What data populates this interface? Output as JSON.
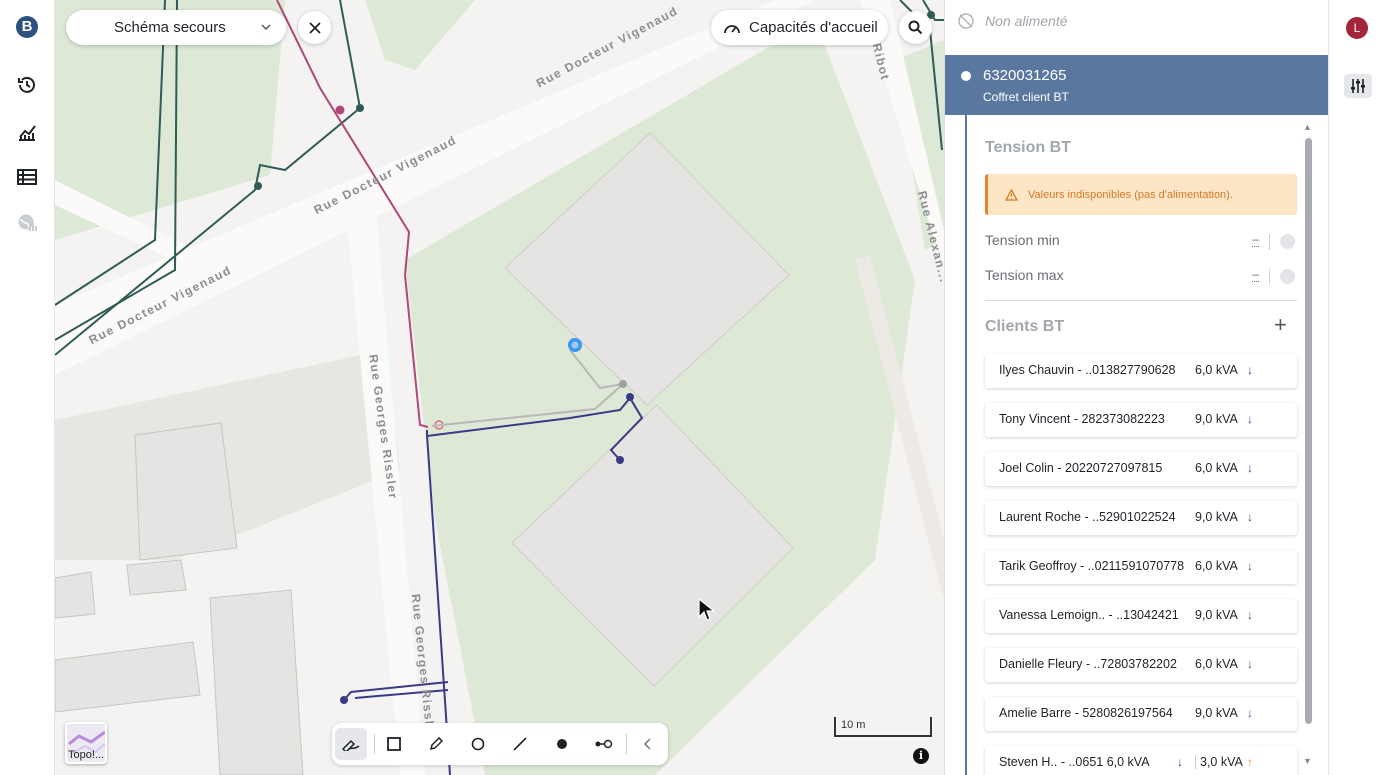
{
  "nav": {
    "logo_letter": "B",
    "items": [
      {
        "name": "history-icon"
      },
      {
        "name": "chart-icon"
      },
      {
        "name": "table-icon"
      },
      {
        "name": "globe-chart-icon"
      }
    ]
  },
  "map": {
    "schema_select_label": "Schéma secours",
    "capacity_button_label": "Capacités d'accueil",
    "streets": {
      "docteur_vigenaud_1": "Rue Docteur Vigenaud",
      "docteur_vigenaud_2": "Rue Docteur Vigenaud",
      "docteur_vigenaud_3": "Rue Docteur Vigenaud",
      "georges_rissler_1": "Rue Georges Rissler",
      "georges_rissler_2": "Rue Georges Rissler",
      "ribot": "Ribot",
      "alexandre": "Rue Alexan..."
    },
    "scale_label": "10 m",
    "topo_label": "Topo!...",
    "info_label": "i"
  },
  "toolbar": {
    "tools": [
      "freehand-draw-icon",
      "rectangle-icon",
      "pencil-icon",
      "circle-icon",
      "line-icon",
      "point-icon",
      "connector-icon",
      "collapse-chevron-icon"
    ]
  },
  "panel": {
    "not_powered_label": "Non alimenté",
    "selected": {
      "id": "6320031265",
      "type": "Coffret client BT"
    },
    "tension_section": {
      "title": "Tension BT",
      "warning": "Valeurs indisponibles (pas d'alimentation).",
      "rows": [
        {
          "label": "Tension min",
          "value": "–"
        },
        {
          "label": "Tension max",
          "value": "–"
        }
      ]
    },
    "clients_section": {
      "title": "Clients BT",
      "add_label": "+",
      "clients": [
        {
          "name": "Ilyes Chauvin -  ..013827790628",
          "kva": "6,0 kVA",
          "arrow": "↓"
        },
        {
          "name": "Tony Vincent - 282373082223",
          "kva": "9,0 kVA",
          "arrow": "↓"
        },
        {
          "name": "Joel Colin - 20220727097815",
          "kva": "6,0 kVA",
          "arrow": "↓"
        },
        {
          "name": "Laurent Roche -  ..52901022524",
          "kva": "9,0 kVA",
          "arrow": "↓"
        },
        {
          "name": "Tarik Geoffroy - ..0211591070778",
          "kva": "6,0 kVA",
          "arrow": "↓"
        },
        {
          "name": "Vanessa Lemoign.. -  ..13042421",
          "kva": "9,0 kVA",
          "arrow": "↓"
        },
        {
          "name": "Danielle Fleury -  ..72803782202",
          "kva": "6,0 kVA",
          "arrow": "↓"
        },
        {
          "name": "Amelie Barre - 5280826197564",
          "kva": "9,0 kVA",
          "arrow": "↓"
        },
        {
          "name": "Steven H..  -  ..0651  6,0 kVA",
          "kva": "3,0 kVA",
          "arrow": "↑",
          "arrow2": "↓"
        }
      ]
    }
  },
  "rail": {
    "avatar_letter": "L"
  },
  "colors": {
    "accent": "#5a789f",
    "brand": "#2d5080",
    "warning_bg": "#fde6c6",
    "warning_text": "#d57a26",
    "network_green": "#2f5c56",
    "network_magenta": "#b0487a",
    "network_navy": "#3b3a86",
    "avatar": "#a4263a"
  }
}
